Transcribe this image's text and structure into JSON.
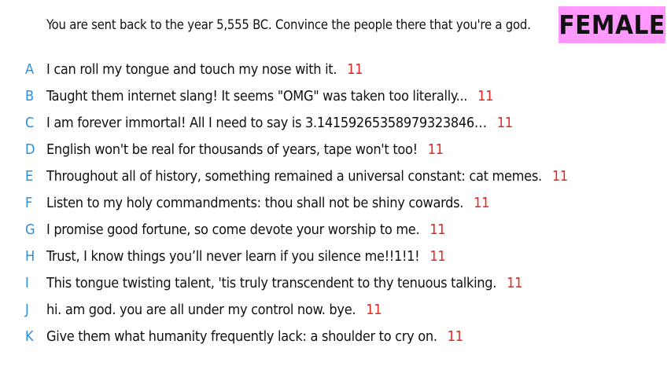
{
  "prompt": "You are sent back to the year 5,555 BC. Convince the people there that you're a god.",
  "badge": "FEMALE",
  "colors": {
    "badge_bg": "#ff99ff",
    "letter": "#2a8fe0",
    "score": "#e8261c"
  },
  "answers": [
    {
      "letter": "A",
      "text": "I can roll my tongue and touch my nose with it.",
      "score": "11"
    },
    {
      "letter": "B",
      "text": "Taught them internet slang! It seems \"OMG\" was taken too literally...",
      "score": "11"
    },
    {
      "letter": "C",
      "text": "I am forever immortal! All I need to say is 3.14159265358979323846…",
      "score": "11"
    },
    {
      "letter": "D",
      "text": "English won't be real for thousands of years, tape won't too!",
      "score": "11"
    },
    {
      "letter": "E",
      "text": "Throughout all of history, something remained a universal constant: cat memes.",
      "score": "11"
    },
    {
      "letter": "F",
      "text": "Listen to my holy commandments: thou shall not be shiny cowards.",
      "score": "11"
    },
    {
      "letter": "G",
      "text": "I promise good fortune, so come devote your worship to me.",
      "score": "11"
    },
    {
      "letter": "H",
      "text": "Trust, I know things you’ll never learn if you silence me!!1!1!",
      "score": "11"
    },
    {
      "letter": "I",
      "text": "This tongue twisting talent, 'tis truly transcendent to thy tenuous talking.",
      "score": "11"
    },
    {
      "letter": "J",
      "text": "hi. am god. you are all under my control now. bye.",
      "score": "11"
    },
    {
      "letter": "K",
      "text": "Give them what humanity frequently lack: a shoulder to cry on.",
      "score": "11"
    }
  ]
}
